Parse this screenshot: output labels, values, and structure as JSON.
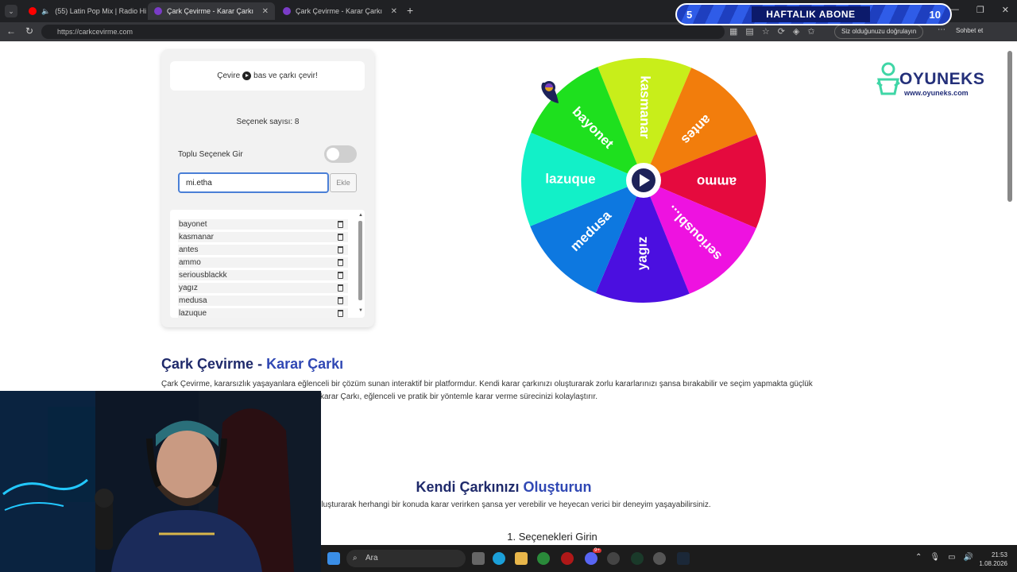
{
  "browser": {
    "tabs": [
      {
        "label": "(55) Latin Pop Mix | Radio Hit…",
        "color": "#ff0000"
      },
      {
        "label": "Çark Çevirme - Karar Çarkı",
        "color": "#7a3cc7"
      },
      {
        "label": "Çark Çevirme - Karar Çarkı",
        "color": "#7a3cc7"
      }
    ],
    "url": "https://carkcevirme.com",
    "verify_label": "Siz olduğunuzu doğrulayın",
    "chat_label": "Sohbet et"
  },
  "overlay": {
    "left_number": "5",
    "label": "HAFTALIK ABONE",
    "right_number": "10"
  },
  "panel": {
    "hint_before": "Çevire",
    "hint_after": "bas ve çarkı çevir!",
    "option_count": "Seçenek sayısı: 8",
    "bulk_label": "Toplu Seçenek Gir",
    "bulk_enabled": false,
    "input_value": "mi.etha",
    "add_label": "Ekle",
    "options": [
      "bayonet",
      "kasmanar",
      "antes",
      "ammo",
      "seriousblackk",
      "yagız",
      "medusa",
      "lazuque"
    ]
  },
  "wheel": {
    "segments": [
      {
        "label": "kasmanar",
        "color": "#c8ee1a"
      },
      {
        "label": "antes",
        "color": "#f27d0c"
      },
      {
        "label": "ammo",
        "color": "#e50a3e"
      },
      {
        "label": "seriousbl...",
        "color": "#ee12e0"
      },
      {
        "label": "yagız",
        "color": "#4b0fe0"
      },
      {
        "label": "medusa",
        "color": "#0d78e0"
      },
      {
        "label": "lazuque",
        "color": "#12f0c8"
      },
      {
        "label": "bayonet",
        "color": "#1ee01e"
      }
    ]
  },
  "logo": {
    "name": "OYUNEKS",
    "url": "www.oyuneks.com"
  },
  "content": {
    "title_main": "Çark Çevirme - ",
    "title_accent": "Karar Çarkı",
    "paragraph_line1": "Çark Çevirme, kararsızlık yaşayanlara eğlenceli bir çözüm sunan interaktif bir platformdur. Kendi karar çarkınızı oluşturarak zorlu kararlarınızı şansa bırakabilir ve seçim yapmakta güçlük",
    "paragraph_line2": "karar Çarkı, eğlenceli ve pratik bir yöntemle karar verme sürecinizi kolaylaştırır.",
    "section_main": "Kendi Çarkınızı ",
    "section_accent": "Oluşturun",
    "section_text": "arkınızı oluşturarak herhangi bir konuda karar verirken şansa yer verebilir ve heyecan verici bir deneyim yaşayabilirsiniz.",
    "step1": "1. Seçenekleri Girin"
  },
  "taskbar": {
    "search": "Ara",
    "time": "21:53",
    "date": "1.08.2026",
    "badge": "9+"
  }
}
